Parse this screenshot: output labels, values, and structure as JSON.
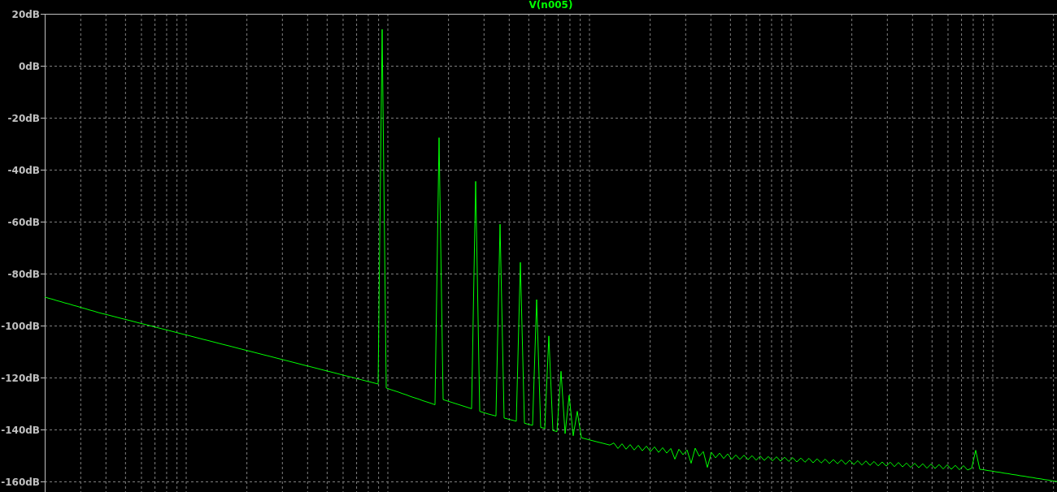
{
  "plot": {
    "chart_data": {
      "type": "line",
      "grid": true,
      "ylim": [
        -160,
        20
      ],
      "yticks": [
        {
          "value": 20,
          "label": "20dB"
        },
        {
          "value": 0,
          "label": "0dB"
        },
        {
          "value": -20,
          "label": "-20dB"
        },
        {
          "value": -40,
          "label": "-40dB"
        },
        {
          "value": -60,
          "label": "-60dB"
        },
        {
          "value": -80,
          "label": "-80dB"
        },
        {
          "value": -100,
          "label": "-100dB"
        },
        {
          "value": -120,
          "label": "-120dB"
        },
        {
          "value": -140,
          "label": "-140dB"
        },
        {
          "value": -160,
          "label": "-160dB"
        }
      ],
      "series": [
        {
          "name": "V(n005)",
          "color": "#00ff00",
          "values": [
            -89.0,
            -89.5,
            -89.9,
            -90.4,
            -90.8,
            -91.3,
            -91.7,
            -92.2,
            -92.6,
            -93.1,
            -93.5,
            -94.0,
            -94.4,
            -94.9,
            -95.3,
            -95.7,
            -96.1,
            -96.5,
            -96.9,
            -97.3,
            -97.7,
            -98.1,
            -98.5,
            -98.9,
            -99.3,
            -99.7,
            -100.1,
            -100.5,
            -100.9,
            -101.3,
            -101.7,
            -102.1,
            -102.5,
            -102.9,
            -103.3,
            -103.7,
            -104.1,
            -104.5,
            -104.9,
            -105.3,
            -105.7,
            -106.1,
            -106.5,
            -106.9,
            -107.3,
            -107.7,
            -108.1,
            -108.5,
            -108.9,
            -109.3,
            -109.7,
            -110.1,
            -110.5,
            -110.9,
            -111.3,
            -111.7,
            -112.1,
            -112.5,
            -112.9,
            -113.3,
            -113.7,
            -114.1,
            -114.5,
            -114.9,
            -115.3,
            -115.7,
            -116.1,
            -116.5,
            -116.9,
            -117.3,
            -117.7,
            -118.1,
            -118.5,
            -118.9,
            -119.3,
            -119.7,
            -120.1,
            -120.5,
            -120.9,
            -121.3,
            -121.7,
            -122.1,
            -122.5,
            14,
            -124.0,
            -124.6,
            -125.1,
            -125.6,
            -126.2,
            -126.7,
            -127.3,
            -127.8,
            -128.3,
            -128.9,
            -129.4,
            -129.9,
            -130.5,
            -27.7,
            -128.5,
            -129.0,
            -129.5,
            -130.0,
            -130.5,
            -131.0,
            -131.5,
            -132.0,
            -44.5,
            -133.0,
            -133.5,
            -134.0,
            -134.4,
            -134.8,
            -61,
            -135.6,
            -136.0,
            -136.4,
            -136.8,
            -75.7,
            -137.6,
            -138.0,
            -138.4,
            -90,
            -139.2,
            -139.6,
            -104,
            -140.4,
            -140.8,
            -117.6,
            -141.6,
            -126.8,
            -142.4,
            -133,
            -143.2,
            -143.6,
            -144.0,
            -144.4,
            -144.8,
            -145.2,
            -145.6,
            -146.0,
            -145.2,
            -147.3,
            -145.5,
            -147.6,
            -145.8,
            -147.9,
            -146.1,
            -148.2,
            -146.4,
            -148.5,
            -146.7,
            -148.8,
            -147.0,
            -149.1,
            -147.3,
            -151.4,
            -147.6,
            -149.7,
            -147.9,
            -153.0,
            -147.2,
            -150.3,
            -148.5,
            -154.6,
            -148.8,
            -150.9,
            -149.1,
            -151.2,
            -149.4,
            -151.5,
            -149.8,
            -151.5,
            -149.9,
            -151.6,
            -150.1,
            -151.8,
            -150.2,
            -151.9,
            -150.4,
            -152.1,
            -150.5,
            -152.2,
            -150.7,
            -152.3,
            -150.8,
            -152.5,
            -151.0,
            -152.6,
            -151.1,
            -152.8,
            -151.3,
            -152.9,
            -151.4,
            -153.1,
            -151.6,
            -153.2,
            -151.7,
            -153.4,
            -151.8,
            -153.5,
            -152.0,
            -153.7,
            -152.1,
            -153.8,
            -152.3,
            -154.0,
            -152.5,
            -154.1,
            -152.6,
            -154.3,
            -152.7,
            -154.4,
            -152.9,
            -154.6,
            -153.0,
            -154.7,
            -153.2,
            -154.9,
            -153.3,
            -155.0,
            -153.5,
            -155.2,
            -153.6,
            -155.3,
            -153.8,
            -155.5,
            -153.9,
            -155.6,
            -154.9,
            -148,
            -155.3,
            -155.5,
            -155.8,
            -156.0,
            -156.3,
            -156.5,
            -156.8,
            -157.0,
            -157.3,
            -157.5,
            -157.8,
            -158.0,
            -158.3,
            -158.5,
            -158.8,
            -159.0,
            -159.3,
            -159.5,
            -159.8,
            -160.0
          ]
        }
      ]
    }
  }
}
